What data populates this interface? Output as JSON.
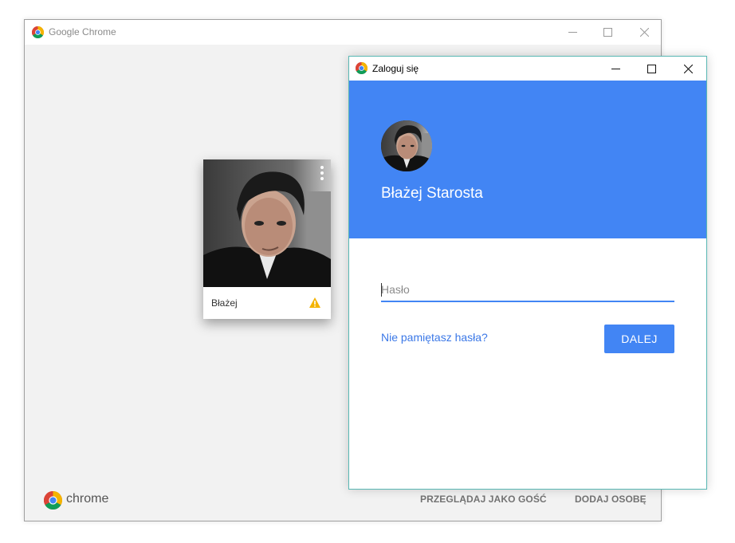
{
  "main_window": {
    "title": "Google Chrome",
    "profile": {
      "name": "Błażej",
      "warning_icon": "warning-triangle-icon"
    },
    "footer": {
      "brand": "chrome",
      "browse_as_guest": "PRZEGLĄDAJ JAKO GOŚĆ",
      "add_person": "DODAJ OSOBĘ"
    }
  },
  "dialog": {
    "title": "Zaloguj się",
    "user_name": "Błażej Starosta",
    "password": {
      "value": "",
      "placeholder": "Hasło"
    },
    "forgot_password": "Nie pamiętasz hasła?",
    "next_button": "DALEJ"
  },
  "colors": {
    "accent_blue": "#4285f4",
    "link_blue": "#3b78e7",
    "dialog_border": "#58b7b3",
    "warning": "#f4b400"
  }
}
